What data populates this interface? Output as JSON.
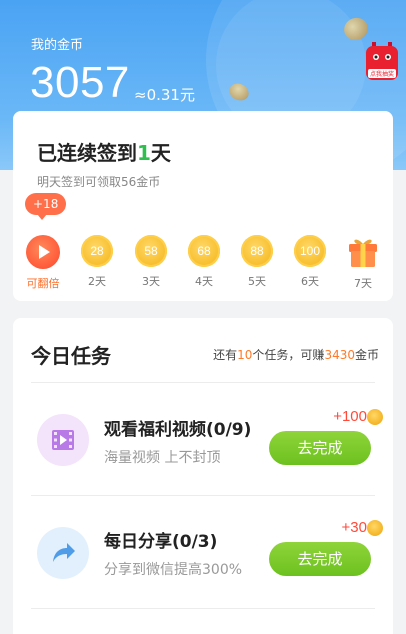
{
  "header": {
    "label": "我的金币",
    "amount": "3057",
    "yuan": "≈0.31元",
    "mascot_text": "点我抽奖"
  },
  "signin": {
    "title_prefix": "已连续签到",
    "days": "1",
    "title_suffix": "天",
    "subtitle": "明天签到可领取56金币",
    "badge": "+18",
    "items": [
      {
        "value": "",
        "label": "可翻倍",
        "icon": "play-icon"
      },
      {
        "value": "28",
        "label": "2天"
      },
      {
        "value": "58",
        "label": "3天"
      },
      {
        "value": "68",
        "label": "4天"
      },
      {
        "value": "88",
        "label": "5天"
      },
      {
        "value": "100",
        "label": "6天"
      },
      {
        "value": "",
        "label": "7天",
        "icon": "gift-icon"
      }
    ]
  },
  "tasks": {
    "title": "今日任务",
    "summary_prefix": "还有",
    "summary_count": "10",
    "summary_mid": "个任务，可赚",
    "summary_coins": "3430",
    "summary_suffix": "金币",
    "list": [
      {
        "name": "观看福利视频(0/9)",
        "desc": "海量视频 上不封顶",
        "reward": "+100",
        "button": "去完成",
        "icon": "video-icon"
      },
      {
        "name": "每日分享(0/3)",
        "desc": "分享到微信提高300%",
        "reward": "+30",
        "button": "去完成",
        "icon": "share-icon"
      }
    ]
  },
  "colors": {
    "header_blue": "#4aa3f3",
    "accent_green": "#6cc11f",
    "reward_red": "#ff4a3a",
    "highlight_orange": "#ff7a2a"
  }
}
